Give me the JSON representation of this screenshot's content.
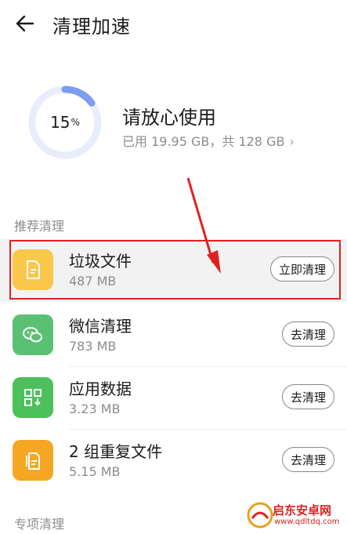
{
  "header": {
    "title": "清理加速"
  },
  "storage": {
    "percent": "15",
    "percent_unit": "%",
    "used_fraction": 0.15,
    "status": "请放心使用",
    "detail": "已用 19.95 GB，共 128 GB"
  },
  "sections": {
    "recommended": "推荐清理",
    "special": "专项清理"
  },
  "items": [
    {
      "name": "垃圾文件",
      "size": "487 MB",
      "button": "立即清理",
      "icon": "file-icon",
      "color": "#f9c84a"
    },
    {
      "name": "微信清理",
      "size": "783 MB",
      "button": "去清理",
      "icon": "wechat-icon",
      "color": "#5ac174"
    },
    {
      "name": "应用数据",
      "size": "3.23 MB",
      "button": "去清理",
      "icon": "app-data-icon",
      "color": "#4cc05a"
    },
    {
      "name": "2 组重复文件",
      "size": "5.15 MB",
      "button": "去清理",
      "icon": "duplicate-file-icon",
      "color": "#f5a623"
    }
  ],
  "watermark": {
    "text": "启东安卓网",
    "url": "www.qdltdq.com"
  },
  "colors": {
    "ring_progress": "#7d9ef0",
    "ring_track": "#e8edfb",
    "highlight": "#e02020"
  }
}
